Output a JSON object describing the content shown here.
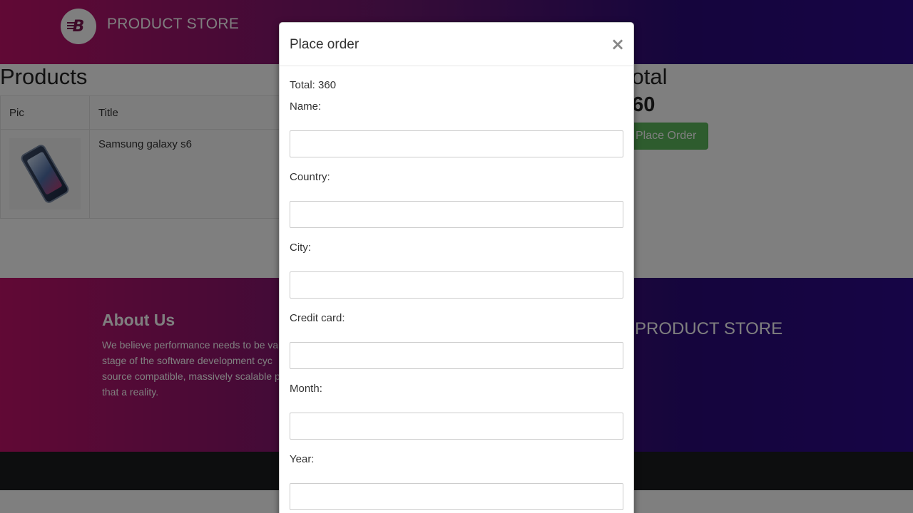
{
  "navbar": {
    "brand_name": "PRODUCT STORE",
    "logo_letter": "B"
  },
  "cart": {
    "heading": "Products",
    "columns": [
      "Pic",
      "Title"
    ],
    "rows": [
      {
        "title": "Samsung galaxy s6",
        "image": "samsung-galaxy-s6-photo"
      }
    ]
  },
  "summary": {
    "heading": "Total",
    "value": "360",
    "button_label": "Place Order"
  },
  "footer": {
    "about_title": "About Us",
    "about_text": "We believe performance needs to be va stage of the software development cyc source compatible, massively scalable p that a reality.",
    "brand_name": "PRODUCT STORE"
  },
  "modal": {
    "title": "Place order",
    "close_symbol": "×",
    "total_text": "Total: 360",
    "fields": [
      {
        "label": "Name:",
        "value": "",
        "placeholder": ""
      },
      {
        "label": "Country:",
        "value": "",
        "placeholder": ""
      },
      {
        "label": "City:",
        "value": "",
        "placeholder": ""
      },
      {
        "label": "Credit card:",
        "value": "",
        "placeholder": ""
      },
      {
        "label": "Month:",
        "value": "",
        "placeholder": ""
      },
      {
        "label": "Year:",
        "value": "",
        "placeholder": ""
      }
    ]
  },
  "colors": {
    "brand_magenta": "#c2126a",
    "brand_indigo": "#2d0a8c",
    "success_green": "#5cb85c",
    "footer_bar": "#1b1c1e"
  }
}
